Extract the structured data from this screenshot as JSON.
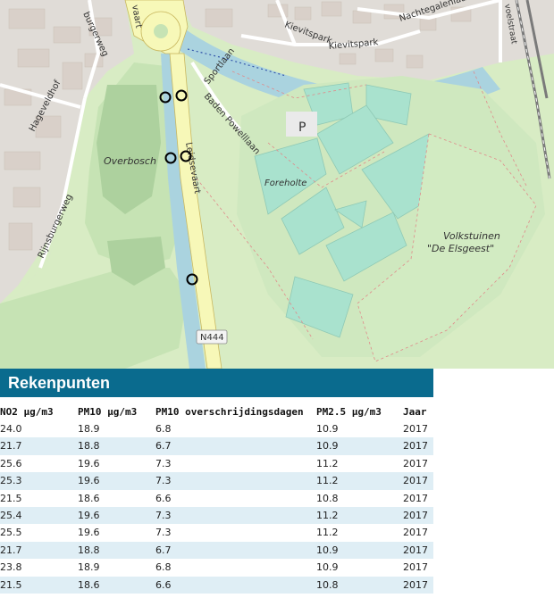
{
  "map": {
    "labels": {
      "kievitspark_1": "Kievitspark",
      "kievitspark_2": "Kievitspark",
      "nachtegalenlaan": "Nachtegalenlaan",
      "sportlaan": "Sportlaan",
      "baden_powelllaan": "Baden Powelllaan",
      "hageveldhof": "Hageveldhof",
      "overbosch": "Overbosch",
      "leidsevaart": "Leidsevaart",
      "leidsevaart_partial": "vaart",
      "leidse_bottom": "Leids",
      "rijnsburgerweg": "Rijnsburgerweg",
      "burgerweg": "burgerweg",
      "foreholte": "Foreholte",
      "volkstuinen_1": "Volkstuinen",
      "volkstuinen_2": "\"De Elsgeest\"",
      "parking": "P",
      "road_shield": "N444",
      "rail_label": "voelstraat"
    },
    "colors": {
      "meadow": "#d8ecc4",
      "park": "#c6e3b4",
      "sport": "#a9e2ce",
      "water": "#aad3df",
      "road_yellow": "#f7f8b8",
      "urban": "#e0dcd7",
      "building": "#d9d0c9"
    },
    "markers": 6
  },
  "panel": {
    "title": "Rekenpunten",
    "columns": [
      "NO2 µg/m3",
      "PM10 µg/m3",
      "PM10 overschrijdingsdagen",
      "PM2.5 µg/m3",
      "Jaar"
    ],
    "rows": [
      [
        "24.0",
        "18.9",
        "6.8",
        "10.9",
        "2017"
      ],
      [
        "21.7",
        "18.8",
        "6.7",
        "10.9",
        "2017"
      ],
      [
        "25.6",
        "19.6",
        "7.3",
        "11.2",
        "2017"
      ],
      [
        "25.3",
        "19.6",
        "7.3",
        "11.2",
        "2017"
      ],
      [
        "21.5",
        "18.6",
        "6.6",
        "10.8",
        "2017"
      ],
      [
        "25.4",
        "19.6",
        "7.3",
        "11.2",
        "2017"
      ],
      [
        "25.5",
        "19.6",
        "7.3",
        "11.2",
        "2017"
      ],
      [
        "21.7",
        "18.8",
        "6.7",
        "10.9",
        "2017"
      ],
      [
        "23.8",
        "18.9",
        "6.8",
        "10.9",
        "2017"
      ],
      [
        "21.5",
        "18.6",
        "6.6",
        "10.8",
        "2017"
      ]
    ]
  }
}
